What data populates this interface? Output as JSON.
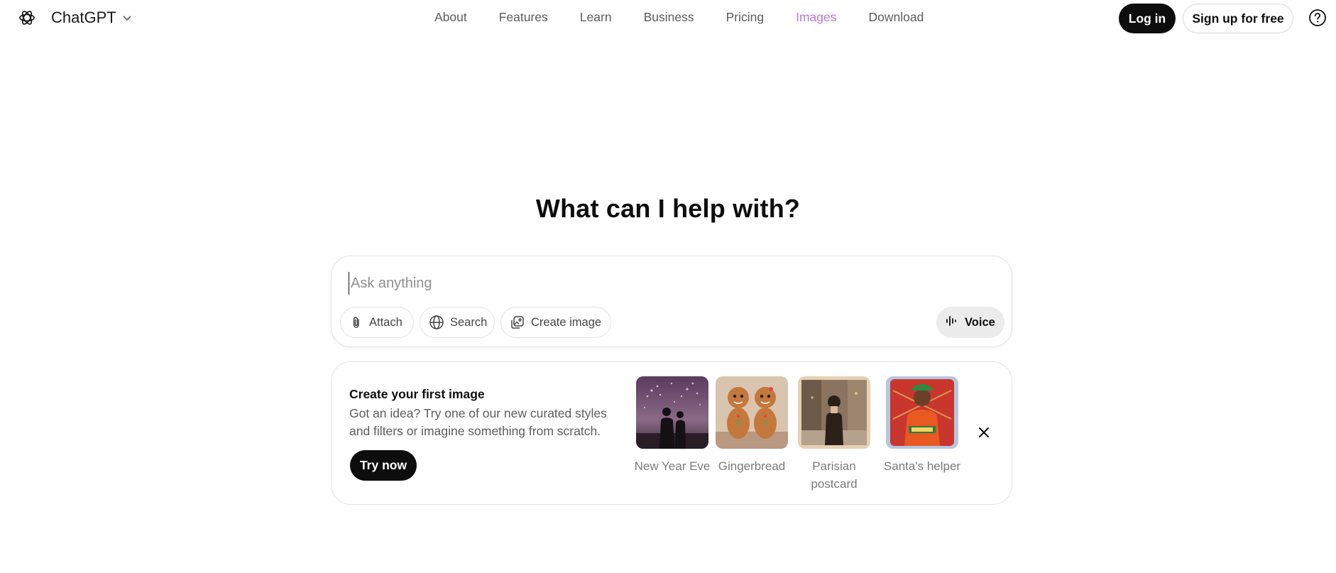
{
  "brand": {
    "name": "ChatGPT",
    "logo_icon": "openai-logo-icon",
    "dropdown_icon": "chevron-down-icon"
  },
  "nav": {
    "items": [
      {
        "label": "About"
      },
      {
        "label": "Features"
      },
      {
        "label": "Learn"
      },
      {
        "label": "Business"
      },
      {
        "label": "Pricing"
      },
      {
        "label": "Images",
        "active": true
      },
      {
        "label": "Download"
      }
    ]
  },
  "auth": {
    "login_label": "Log in",
    "signup_label": "Sign up for free",
    "help_icon": "question-circle-icon"
  },
  "hero": {
    "title": "What can I help with?"
  },
  "composer": {
    "placeholder": "Ask anything",
    "value": "",
    "attach_label": "Attach",
    "search_label": "Search",
    "create_image_label": "Create image",
    "voice_label": "Voice"
  },
  "promo": {
    "title": "Create your first image",
    "description": "Got an idea? Try one of our new curated styles and filters or imagine something from scratch.",
    "try_label": "Try now",
    "styles": [
      {
        "label": "New Year Eve"
      },
      {
        "label": "Gingerbread"
      },
      {
        "label": "Parisian postcard"
      },
      {
        "label": "Santa's helper"
      }
    ]
  },
  "colors": {
    "accent_active_nav": "#b87ad6",
    "primary_button": "#0d0d0d",
    "voice_bg": "#ececec"
  }
}
